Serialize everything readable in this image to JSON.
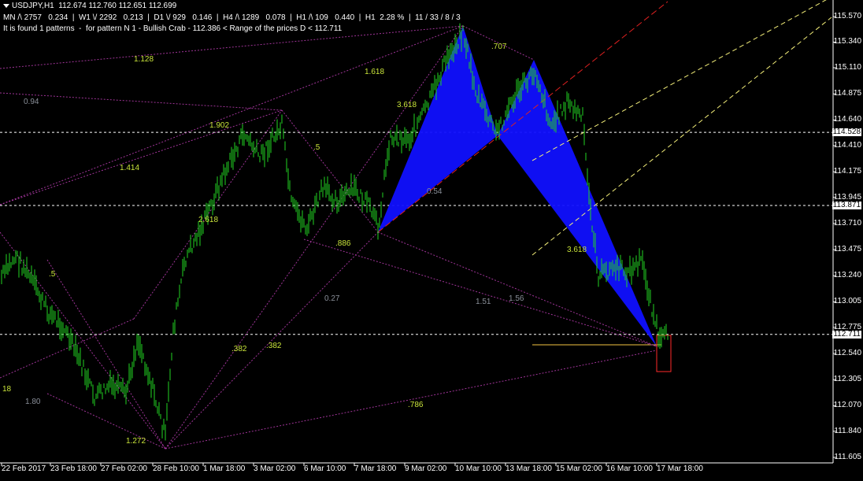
{
  "header": {
    "symbol_line": "USDJPY,H1  112.674 112.760 112.651 112.699",
    "stats_line": "MN /\\ 2757   0.234  |  W1 \\/ 2292   0.213  |  D1 \\/ 929   0.146  |  H4 /\\ 1289   0.078  |  H1 /\\ 109   0.440  |  H1  2.28 %  |  11 / 33 / 8 / 3",
    "pattern_line": "It is found 1 patterns  -  for pattern N 1 - Bullish Crab - 112.386 < Range of the prices D < 112.711"
  },
  "colors": {
    "background": "#000000",
    "candles": "#22d422",
    "pattern_fill": "#1010ff",
    "fib_lines": "#b03aa8",
    "channel_red": "#e02020",
    "channel_yellow": "#f5f07a",
    "labels": "#c8e33a",
    "grey_labels": "#8a8f99",
    "target_box": "#ff2a2a"
  },
  "price_axis": {
    "labels": [
      "115.570",
      "115.340",
      "115.110",
      "114.875",
      "114.640",
      "114.410",
      "114.175",
      "113.945",
      "113.710",
      "113.475",
      "113.240",
      "113.005",
      "112.775",
      "112.540",
      "112.305",
      "112.070",
      "111.840",
      "111.605"
    ],
    "highlighted": [
      "114.528",
      "113.871",
      "112.711"
    ]
  },
  "time_axis": {
    "labels": [
      "22 Feb 2017",
      "23 Feb 18:00",
      "27 Feb 02:00",
      "28 Feb 10:00",
      "1 Mar 18:00",
      "3 Mar 02:00",
      "6 Mar 10:00",
      "7 Mar 18:00",
      "9 Mar 02:00",
      "10 Mar 10:00",
      "13 Mar 18:00",
      "15 Mar 02:00",
      "16 Mar 10:00",
      "17 Mar 18:00"
    ]
  },
  "annotations": {
    "fib_1128": "1.128",
    "fib_1618_top": "1.618",
    "fib_707": ".707",
    "fib_094": "0.94",
    "fib_3618_top": "3.618",
    "fib_1902": "1.902",
    "fib_5_mid": ".5",
    "fib_1414": "1.414",
    "fib_054": "0.54",
    "fib_2618": "2.618",
    "fib_886": ".886",
    "fib_3618_right": "3.618",
    "fib_5_left": ".5",
    "fib_027": "0.27",
    "fib_151": "1.51",
    "fib_156": "1.56",
    "fib_382_a": ".382",
    "fib_382_b": ".382",
    "fib_18": "18",
    "fib_180": "1.80",
    "fib_786": ".786",
    "fib_1272": "1.272"
  }
}
